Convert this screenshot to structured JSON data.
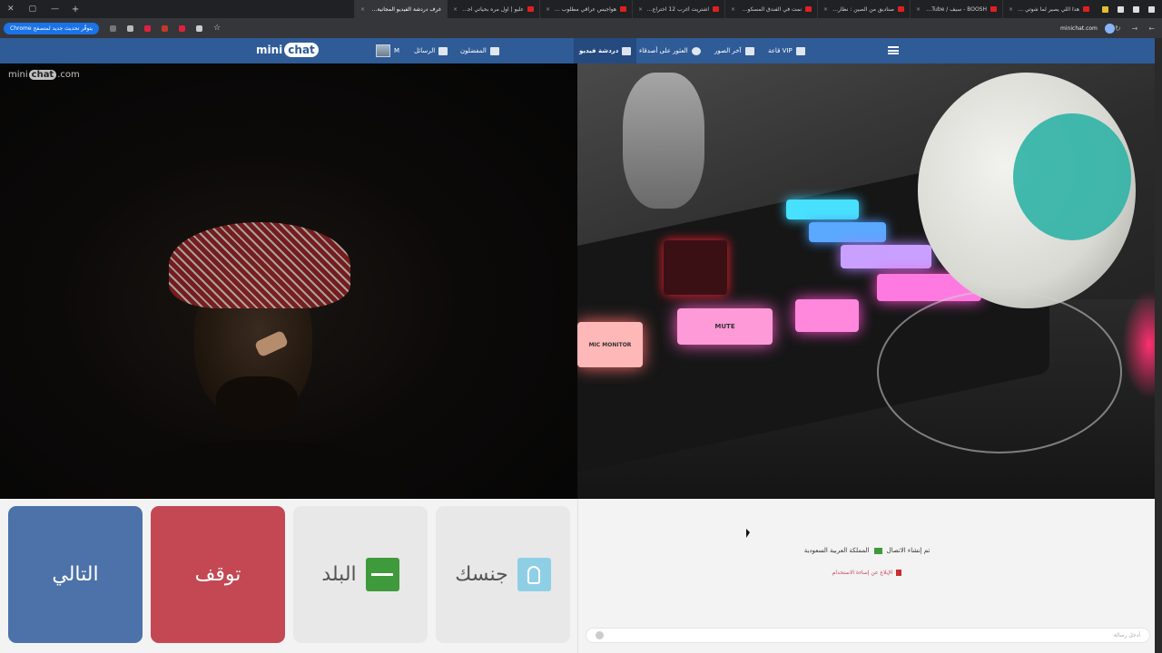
{
  "browser": {
    "tabs": [
      {
        "title": "هذا اللي يصير لما شوتي طفشان",
        "icon": "youtube"
      },
      {
        "title": "BOOSH - سيف / YouTube",
        "icon": "youtube"
      },
      {
        "title": "صناديق من الصين : نظارة مهما ...",
        "icon": "youtube"
      },
      {
        "title": "نمت في الفندق المسكون - اصوا...",
        "icon": "youtube"
      },
      {
        "title": "اشتريت أغرب 12 اختراع من شي إن",
        "icon": "youtube"
      },
      {
        "title": "هواجيس عراقي مطلوب ٥٠٠ ...",
        "icon": "youtube"
      },
      {
        "title": "عليو | اول مره بحياتي اجرب سيار...",
        "icon": "youtube"
      },
      {
        "title": "غرف دردشة الفيديو المجانية...",
        "icon": "chat",
        "active": true
      }
    ],
    "update_pill": "يتوفّر تحديث جديد لمتصفح Chrome",
    "url": "minichat.com"
  },
  "site": {
    "logo_left": "mini",
    "logo_right": "chat",
    "nav": {
      "vip": "VIP قاعة",
      "photos": "آخر الصور",
      "search": "العثور على أصدقاء",
      "video_chat": "دردشة فيديو",
      "favorites": "المفضلون",
      "messages": "الرسائل",
      "user_initial": "M"
    }
  },
  "video": {
    "watermark_left": "mini",
    "watermark_mid": "chat",
    "watermark_right": ".com",
    "keys": [
      "MUTE",
      "MIC MONITOR"
    ]
  },
  "controls": {
    "next": "التالي",
    "stop": "توقف",
    "country": "البلد",
    "gender": "جنسك"
  },
  "chat": {
    "status_prefix": "تم إنشاء الاتصال",
    "status_country": "المملكة العربية السعودية",
    "report": "الإبلاغ عن إساءة الاستخدام",
    "input_placeholder": "أدخل رسالة"
  },
  "colors": {
    "header": "#2f5b97",
    "next": "#4c72a9",
    "stop": "#c34853",
    "saudi_green": "#3e9a3a"
  }
}
